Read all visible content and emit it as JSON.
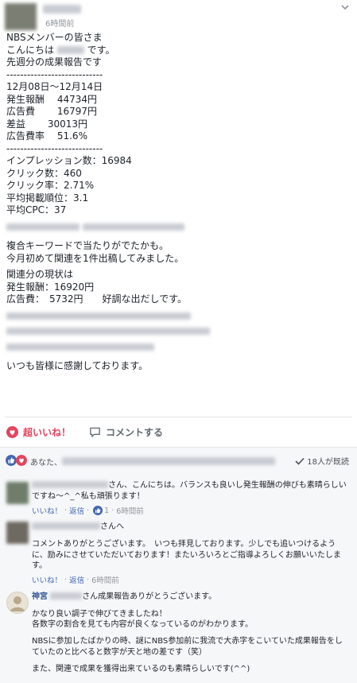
{
  "post": {
    "time": "6時間前",
    "body": {
      "greeting": [
        "NBSメンバーの皆さま",
        "こんにちは",
        "です。",
        "先週分の成果報告です"
      ],
      "sep": "----------------------------",
      "period": "12月08日〜12月14日",
      "stats": [
        {
          "label": "発生報酬",
          "value": "44734円"
        },
        {
          "label": "広告費",
          "value": "16797円"
        },
        {
          "label": "差益",
          "value": "30013円"
        },
        {
          "label": "広告費率",
          "value": "51.6%"
        }
      ],
      "metrics": [
        "インプレッション数：16984",
        "クリック数：460",
        "クリック率：2.71%",
        "平均掲載順位：3.1",
        "平均CPC：37"
      ],
      "paragraph1": [
        "複合キーワードで当たりがでたかも。",
        "今月初めて関連を1件出稿してみました。"
      ],
      "related": [
        "関連分の現状は",
        "発生報酬：16920円",
        "広告費：　5732円　　好調な出だしです。"
      ],
      "closing": "いつも皆様に感謝しております。"
    }
  },
  "actions": {
    "like_label": "超いいね！",
    "comment_label": "コメントする"
  },
  "reactions": {
    "you_label": "あなた、",
    "shares": "18人が既読"
  },
  "comments": [
    {
      "text": "さん、こんにちは。バランスも良いし発生報酬の伸びも素晴らしいですね〜^_^私も頑張ります！",
      "like": "いいね！",
      "reply": "返信",
      "count": "1",
      "time": "6時間前"
    },
    {
      "name_suffix": "さんへ",
      "text": "コメントありがとうございます。　いつも拝見しております。少しでも追いつけるように、励みにさせていただいております！またいろいろとご指導よろしくお願いいたします。",
      "like": "いいね！",
      "reply": "返信",
      "time": "6時間前"
    },
    {
      "name": "神宮",
      "text_head": "さん成果報告ありがとうございます。",
      "p1": "かなり良い調子で伸びてきましたね！",
      "p2": "各数字の割合を見ても内容が良くなっているのがわかります。",
      "p3": "NBSに参加したばかりの時、謎にNBS参加前に我流で大赤字をこいていた成果報告をしていたのと比べると数字が天と地の差です（笑）",
      "p4": "また、関連で成果を獲得出来ているのも素晴らしいです(^^)"
    }
  ],
  "colors": {
    "accent": "#4267b2",
    "love": "#e4445e",
    "link": "#365899"
  }
}
